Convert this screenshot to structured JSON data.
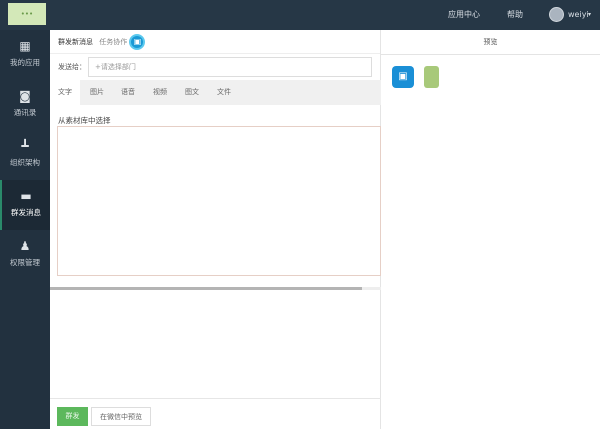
{
  "top": {
    "logo": "logo",
    "app_center": "应用中心",
    "help": "帮助",
    "user": "weiyi"
  },
  "sidebar": {
    "items": [
      {
        "label": "我的应用",
        "icon": "grid-icon"
      },
      {
        "label": "通讯录",
        "icon": "contacts-icon"
      },
      {
        "label": "组织架构",
        "icon": "org-chart-icon"
      },
      {
        "label": "群发消息",
        "icon": "message-icon"
      },
      {
        "label": "权限管理",
        "icon": "user-gear-icon"
      }
    ]
  },
  "main": {
    "title": "群发新消息",
    "subtitle": "任务协作",
    "send_to_label": "发送给：",
    "send_to_placeholder": "+请选择部门",
    "tabs": [
      "文字",
      "图片",
      "语音",
      "视频",
      "图文",
      "文件"
    ],
    "library_link": "从素材库中选择",
    "send_button": "群发",
    "preview_button": "在微信中预览"
  },
  "preview": {
    "title": "预览"
  },
  "colors": {
    "topbar": "#263746",
    "sidebar": "#22313f",
    "primary": "#5cb85c"
  }
}
